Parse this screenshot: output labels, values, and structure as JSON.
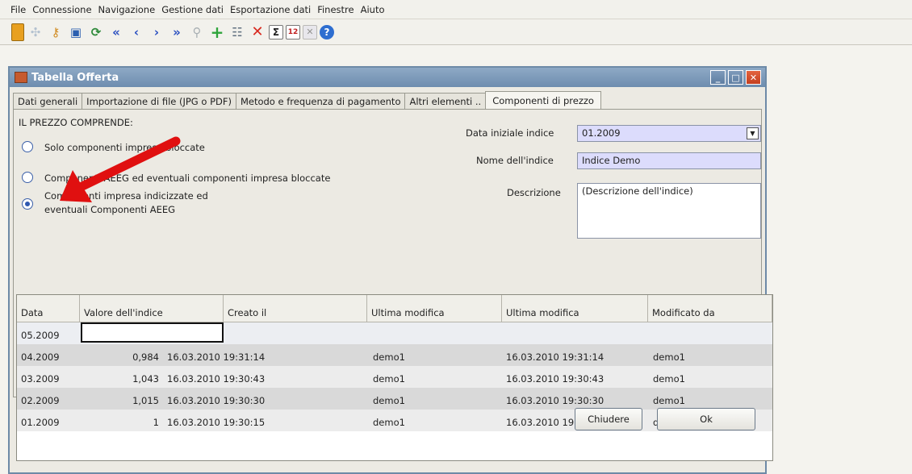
{
  "menu": [
    "File",
    "Connessione",
    "Navigazione",
    "Gestione dati",
    "Esportazione dati",
    "Finestre",
    "Aiuto"
  ],
  "toolbar_icons": [
    "exit-icon",
    "tools-icon",
    "user-key-icon",
    "save-icon",
    "refresh-icon",
    "first-record-icon",
    "prev-record-icon",
    "next-record-icon",
    "last-record-icon",
    "search-icon",
    "add-icon",
    "settings-icon",
    "delete-icon",
    "sum-icon",
    "calendar-icon",
    "excel-icon",
    "help-icon"
  ],
  "window": {
    "title": "Tabella Offerta"
  },
  "tabs": [
    "Dati generali",
    "Importazione di file (JPG o PDF)",
    "Metodo e frequenza di pagamento",
    "Altri elementi ..",
    "Componenti di prezzo"
  ],
  "form": {
    "heading": "IL PREZZO COMPRENDE:",
    "options": [
      "Solo componenti impresa bloccate",
      "Componenti AEEG ed eventuali componenti impresa bloccate",
      "Componenti impresa indicizzate ed",
      "eventuali Componenti AEEG"
    ],
    "data_iniziale_label": "Data iniziale indice",
    "data_iniziale_value": "01.2009",
    "nome_label": "Nome dell'indice",
    "nome_value": "Indice Demo",
    "descrizione_label": "Descrizione",
    "descrizione_value": "(Descrizione dell'indice)"
  },
  "table": {
    "columns": [
      "Data",
      "Valore dell'indice",
      "Creato il",
      "Ultima modifica",
      "Ultima modifica",
      "Modificato da"
    ],
    "rows": [
      [
        "05.2009",
        "",
        "",
        "",
        "",
        ""
      ],
      [
        "04.2009",
        "0,984",
        "16.03.2010 19:31:14",
        "demo1",
        "16.03.2010 19:31:14",
        "demo1"
      ],
      [
        "03.2009",
        "1,043",
        "16.03.2010 19:30:43",
        "demo1",
        "16.03.2010 19:30:43",
        "demo1"
      ],
      [
        "02.2009",
        "1,015",
        "16.03.2010 19:30:30",
        "demo1",
        "16.03.2010 19:30:30",
        "demo1"
      ],
      [
        "01.2009",
        "1",
        "16.03.2010 19:30:15",
        "demo1",
        "16.03.2010 19:30:15",
        "demo1"
      ]
    ]
  },
  "buttons": {
    "close": "Chiudere",
    "ok": "Ok"
  },
  "colors": {
    "titlebar": "#7a97b8",
    "field": "#dcdcfc",
    "arrow": "#e01010"
  }
}
